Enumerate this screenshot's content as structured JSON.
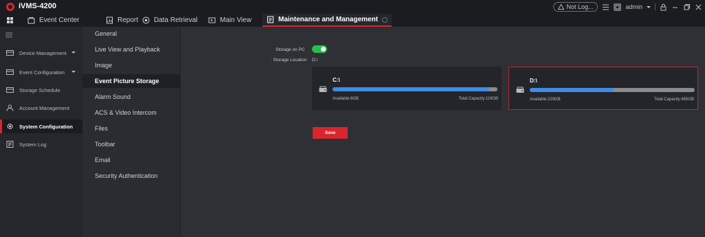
{
  "app": {
    "title": "iVMS-4200"
  },
  "titlebar": {
    "status": "Not Log...",
    "user": "admin"
  },
  "tabs": [
    {
      "label": "Event Center",
      "icon": "event-center-icon"
    },
    {
      "label": "Report",
      "icon": "report-icon"
    },
    {
      "label": "Data Retrieval",
      "icon": "data-retrieval-icon"
    },
    {
      "label": "Main View",
      "icon": "main-view-icon"
    },
    {
      "label": "Maintenance and Management",
      "icon": "maintenance-icon",
      "active": true
    }
  ],
  "leftnav": {
    "items": [
      {
        "label": "Device Management",
        "icon": "device-management-icon",
        "expandable": true
      },
      {
        "label": "Event Configuration",
        "icon": "event-configuration-icon",
        "expandable": true
      },
      {
        "label": "Storage Schedule",
        "icon": "storage-schedule-icon"
      },
      {
        "label": "Account Management",
        "icon": "account-icon"
      },
      {
        "label": "System Configuration",
        "icon": "gear-icon",
        "active": true
      },
      {
        "label": "System Log",
        "icon": "system-log-icon"
      }
    ]
  },
  "submenu": {
    "items": [
      {
        "label": "General"
      },
      {
        "label": "Live View and Playback"
      },
      {
        "label": "Image"
      },
      {
        "label": "Event Picture Storage",
        "active": true
      },
      {
        "label": "Alarm Sound"
      },
      {
        "label": "ACS & Video Intercom"
      },
      {
        "label": "Files"
      },
      {
        "label": "Toolbar"
      },
      {
        "label": "Email"
      },
      {
        "label": "Security Authentication"
      }
    ]
  },
  "main": {
    "storage_on_pc_label": "Storage on PC",
    "storage_on_pc_enabled": true,
    "storage_location_required_mark": "*",
    "storage_location_label": "Storage Location",
    "storage_location_value": "D:\\",
    "drives": [
      {
        "name": "C:\\",
        "available": "Available:6GB",
        "total": "Total Capacity:119GB",
        "used_fraction": 0.95,
        "selected": false
      },
      {
        "name": "D:\\",
        "available": "Available:229GB",
        "total": "Total Capacity:465GB",
        "used_fraction": 0.51,
        "selected": true
      }
    ],
    "save_label": "Save"
  },
  "colors": {
    "accent": "#d9262c",
    "toggle_on": "#25c04a",
    "bar_fill": "#3f8de6"
  }
}
